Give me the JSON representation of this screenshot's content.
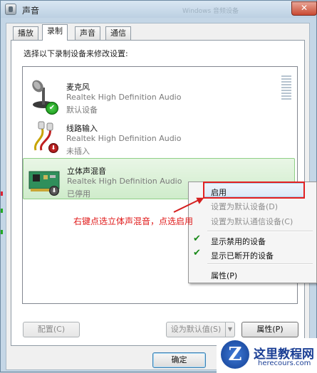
{
  "window": {
    "title": "声音",
    "background_title": "Windows 音频设备"
  },
  "tabs": [
    {
      "label": "播放",
      "active": false
    },
    {
      "label": "录制",
      "active": true
    },
    {
      "label": "声音",
      "active": false
    },
    {
      "label": "通信",
      "active": false
    }
  ],
  "instruction": "选择以下录制设备来修改设置:",
  "devices": [
    {
      "name": "麦克风",
      "driver": "Realtek High Definition Audio",
      "status": "默认设备",
      "icon": "microphone-icon",
      "badge": "default-check"
    },
    {
      "name": "线路输入",
      "driver": "Realtek High Definition Audio",
      "status": "未插入",
      "icon": "line-in-cable-icon",
      "badge": "unplugged"
    },
    {
      "name": "立体声混音",
      "driver": "Realtek High Definition Audio",
      "status": "已停用",
      "icon": "sound-card-icon",
      "badge": "disabled"
    }
  ],
  "buttons": {
    "configure": "配置(C)",
    "set_default": "设为默认值(S)",
    "properties": "属性(P)",
    "ok": "确定"
  },
  "context_menu": {
    "items": [
      {
        "label": "启用",
        "enabled": true,
        "checked": false
      },
      {
        "label": "设置为默认设备(D)",
        "enabled": false,
        "checked": false
      },
      {
        "label": "设置为默认通信设备(C)",
        "enabled": false,
        "checked": false
      },
      {
        "label": "显示禁用的设备",
        "enabled": true,
        "checked": true
      },
      {
        "label": "显示已断开的设备",
        "enabled": true,
        "checked": true
      },
      {
        "label": "属性(P)",
        "enabled": true,
        "checked": false
      }
    ]
  },
  "annotation": "右键点选立体声混音，点选启用",
  "watermark": {
    "name": "这里教程网",
    "url": "herecours.com"
  },
  "colors": {
    "annotation_red": "#e01a1a",
    "selection_green": "#cfeccb",
    "check_green": "#1a8a1a"
  }
}
